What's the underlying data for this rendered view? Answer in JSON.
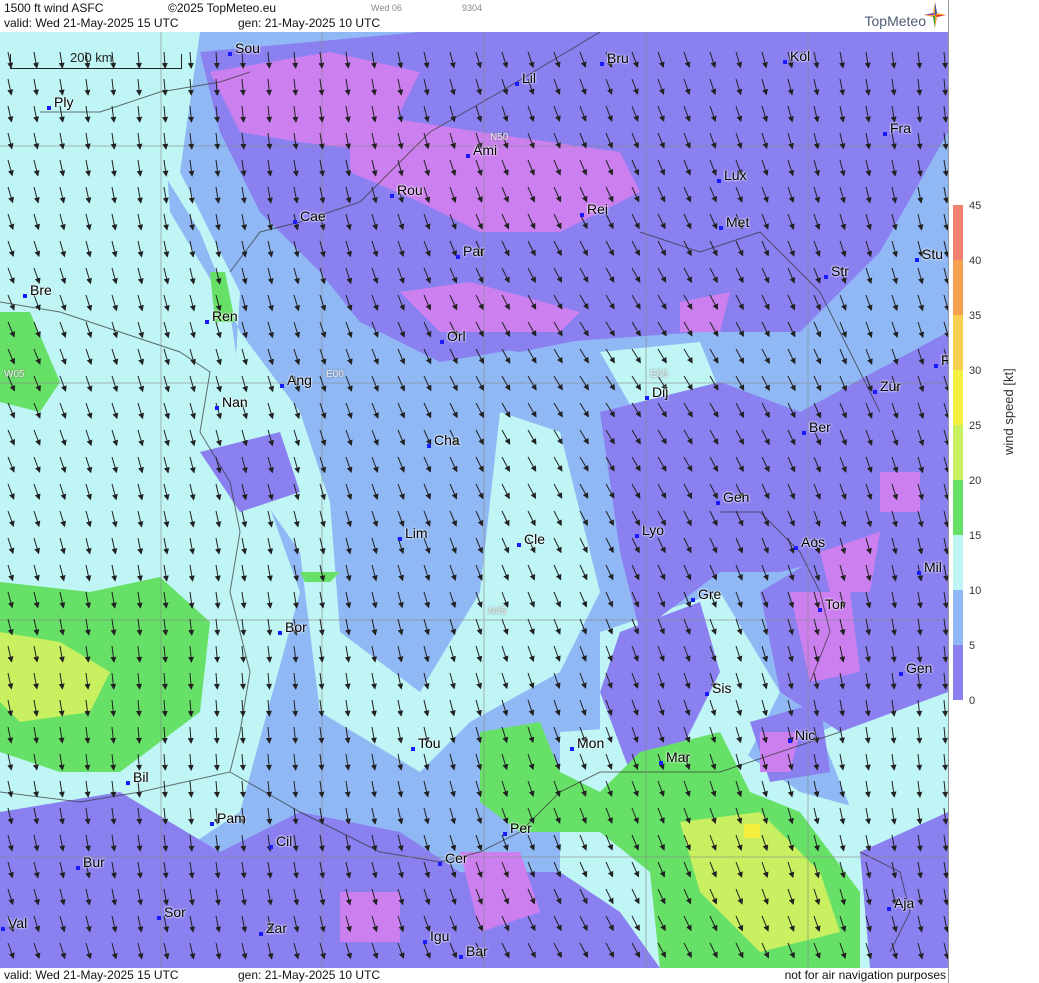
{
  "header": {
    "title": "1500 ft wind ASFC",
    "copyright": "©2025 TopMeteo.eu",
    "day": "Wed 06",
    "code": "9304",
    "valid": "valid:  Wed  21-May-2025  15 UTC",
    "gen": "gen: 21-May-2025 10 UTC",
    "logo": "TopMeteo"
  },
  "footer": {
    "valid": "valid:  Wed  21-May-2025  15 UTC",
    "gen": "gen: 21-May-2025 10 UTC",
    "notice": "not for air navigation purposes"
  },
  "scale_bar": "200 km",
  "grid_labels": [
    "N50",
    "E05",
    "E00",
    "W05",
    "N45"
  ],
  "legend": {
    "title": "wind speed [kt]",
    "ticks": [
      "45",
      "40",
      "35",
      "30",
      "25",
      "20",
      "15",
      "10",
      "5",
      "0"
    ],
    "colors": [
      "#f08070",
      "#f5a050",
      "#f7d050",
      "#f5f040",
      "#c8f060",
      "#66e066",
      "#bff5f5",
      "#8fb8f5",
      "#8a80f0",
      "#cc80f0"
    ]
  },
  "cities": [
    {
      "name": "Sou"
    },
    {
      "name": "Lil"
    },
    {
      "name": "Bru"
    },
    {
      "name": "Köl"
    },
    {
      "name": "Ply"
    },
    {
      "name": "Ami"
    },
    {
      "name": "Fra"
    },
    {
      "name": "Rou"
    },
    {
      "name": "Lux"
    },
    {
      "name": "Cae"
    },
    {
      "name": "Rei"
    },
    {
      "name": "Met"
    },
    {
      "name": "Par"
    },
    {
      "name": "Stu"
    },
    {
      "name": "Str"
    },
    {
      "name": "Bre"
    },
    {
      "name": "Ren"
    },
    {
      "name": "Orl"
    },
    {
      "name": "Ang"
    },
    {
      "name": "Dij"
    },
    {
      "name": "Zür"
    },
    {
      "name": "Nan"
    },
    {
      "name": "Cha"
    },
    {
      "name": "Ber"
    },
    {
      "name": "Gen"
    },
    {
      "name": "Lim"
    },
    {
      "name": "Cle"
    },
    {
      "name": "Lyo"
    },
    {
      "name": "Aos"
    },
    {
      "name": "Mil"
    },
    {
      "name": "Gre"
    },
    {
      "name": "Tor"
    },
    {
      "name": "Bor"
    },
    {
      "name": "Gen"
    },
    {
      "name": "Sis"
    },
    {
      "name": "Nic"
    },
    {
      "name": "Tou"
    },
    {
      "name": "Mon"
    },
    {
      "name": "Mar"
    },
    {
      "name": "Bil"
    },
    {
      "name": "Pam"
    },
    {
      "name": "Per"
    },
    {
      "name": "Cil"
    },
    {
      "name": "Cer"
    },
    {
      "name": "Bur"
    },
    {
      "name": "Ajа"
    },
    {
      "name": "Sor"
    },
    {
      "name": "Val"
    },
    {
      "name": "Zar"
    },
    {
      "name": "Igu"
    },
    {
      "name": "Bar"
    },
    {
      "name": "F"
    }
  ]
}
